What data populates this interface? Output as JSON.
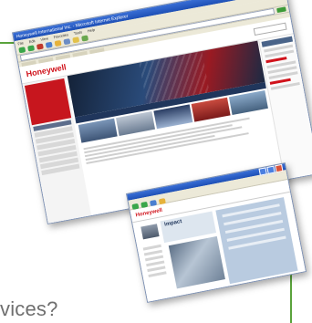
{
  "caption": "vices?",
  "colors": {
    "accent_green": "#5aa33c",
    "brand_red": "#d0121b",
    "titlebar_blue": "#1d4fb5"
  },
  "big_window": {
    "title": "Honeywell International Inc. - Microsoft Internet Explorer",
    "menu": [
      "File",
      "Edit",
      "View",
      "Favorites",
      "Tools",
      "Help"
    ],
    "logo": "Honeywell"
  },
  "small_window": {
    "logo": "Honeywell",
    "heading": "Impact"
  }
}
